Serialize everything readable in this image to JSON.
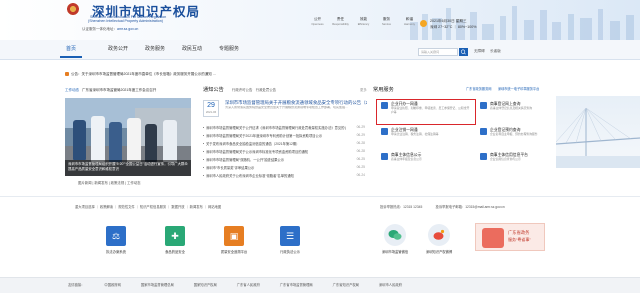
{
  "header": {
    "title": "深圳市知识产权局",
    "title_en_1": "Shenzhen Administration For Market Regulation",
    "title_en_2": "(Shenzhen Intellectual Property Administration)",
    "domain_prefix": "认证服务一体化地址：",
    "domain": "amr.sz.gov.cn",
    "quick_links": [
      {
        "label": "公开",
        "sub": "Openness"
      },
      {
        "label": "责任",
        "sub": "Responsibility"
      },
      {
        "label": "效能",
        "sub": "Efficiency"
      },
      {
        "label": "服务",
        "sub": "Service"
      },
      {
        "label": "和谐",
        "sub": "Harmony"
      }
    ],
    "weather_date": "2021年6月30日 星期三",
    "weather_temp": "深圳 27~32°C  ｜  80%~100%"
  },
  "nav": {
    "items": [
      "首页",
      "政务公开",
      "政务服务",
      "政民互动",
      "专题服务"
    ],
    "active_index": 0,
    "search_placeholder": "请输入关键词",
    "aux": [
      "无障碍",
      "长者版"
    ]
  },
  "ticker": "公告：关于深圳市市场监督管理局2021年度市直单位《市长信箱》政务服务开展公示的通知 ...",
  "left": {
    "head_tag": "工作动态",
    "head_text": "广东省深圳市市场监管局2021年度工作会议召开",
    "photo_caption": "深圳市市场监督管理局组织开展“5·20”“全国公益日”活动进行宣传，引导广大群众提高产品质量安全意识和维权意识",
    "photo_links": "图片新闻 | 新闻发布 | 政策法规 | 工作动态"
  },
  "notices": {
    "title": "通知公告",
    "tabs": "行政许可公告　行政处罚公告",
    "more": "更多",
    "day": "29",
    "month": "2021-06",
    "headline": "深圳市市场监督管理局关于开展粮食流通领域食品安全专项行动的公告（2021年…",
    "headline_summary": "为深入贯彻落实国务院食品安全委员会关于开展粮食流通领域专项检查工作部署，切实加强…",
    "items": [
      {
        "text": "深圳市市场监督管理局关于公开征求《深圳市市场监督管理局行政处罚裁量权实施办法》意见的公告",
        "date": "06-29"
      },
      {
        "text": "深圳市市场监督管理局关于2021年度深圳市专利资助计划第一批拟资助项目公示",
        "date": "06-29"
      },
      {
        "text": "关于发布深圳市食品安全抽检监测信息的通告（2021年第12期）",
        "date": "06-28"
      },
      {
        "text": "深圳市市场监督管理局关于公示深圳市标准化专项资金资助项目的通知",
        "date": "06-28"
      },
      {
        "text": "深圳市市场监督管理局“双随机、一公开”抽查结果公示",
        "date": "06-25"
      },
      {
        "text": "深圳市“市长质量奖”评审结果公示",
        "date": "06-25"
      },
      {
        "text": "深圳市人民政府关于公布深圳市企业标准“领跑者”名单的通知",
        "date": "06-24"
      }
    ]
  },
  "services": {
    "title": "常用服务",
    "links": "广东省政务服务网　　深圳市统一电子印章服务平台",
    "items": [
      {
        "title": "企业开办一网通",
        "sub": "申请营业执照、刻制印章、申领发票、员工参保登记、公积金开户等",
        "color": "#2d6fc8"
      },
      {
        "title": "商事登记网上查询",
        "sub": "商事主体登记信息及相关情况查询",
        "color": "#2d6fc8"
      },
      {
        "title": "企业注销一网通",
        "sub": "申请企业注销、税务注销、社保注销等",
        "color": "#2d6fc8"
      },
      {
        "title": "企业登记预约查询",
        "sub": "企业名称自主申报、预约办理查询服务",
        "color": "#2d6fc8"
      },
      {
        "title": "商事主体信息公示",
        "sub": "商事主体年报及信息公示",
        "color": "#2d6fc8"
      },
      {
        "title": "商事主体信用信息平台",
        "sub": "企业信用信息查询与公示",
        "color": "#2d6fc8"
      }
    ]
  },
  "footer": {
    "links_left": "重大项目选择 ｜ 政策解读 ｜ 规范性文件 ｜ 知识产权信息服务 ｜ 数据开放 ｜ 新闻发布 ｜ 网站地图",
    "links_right": "投诉举报热线：12315  12345　　　　投诉举报电子邮箱：12315@mail.amr.sz.gov.cn",
    "apps": [
      {
        "label": "执法办案系统",
        "color": "#2d6fc8"
      },
      {
        "label": "食品药品安全",
        "color": "#2aa876"
      },
      {
        "label": "质量安全追溯平台",
        "color": "#e67e22"
      },
      {
        "label": "行政执法公示",
        "color": "#2d6fc8"
      }
    ],
    "qrs": [
      "深圳市场监管微信",
      "深圳知识产权微博"
    ],
    "promo_line1": "广东省政务",
    "promo_line2": "服务“粤省事”",
    "bottom_links": [
      "友情链接：",
      "中国政府网",
      "国家市场监督管理总局",
      "国家知识产权局",
      "广东省人民政府",
      "广东省市场监督管理局",
      "广东省知识产权局",
      "深圳市人民政府"
    ]
  }
}
